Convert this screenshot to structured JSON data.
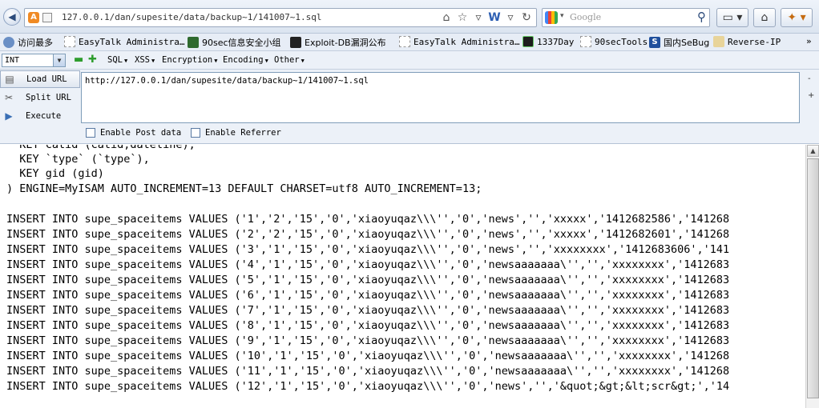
{
  "nav": {
    "url": "127.0.0.1/dan/supesite/data/backup~1/141007~1.sql",
    "search_placeholder": "Google",
    "favicon_letter": "A"
  },
  "bookmarks": [
    {
      "label": "访问最多",
      "icon": "gear-icon"
    },
    {
      "label": "EasyTalk Administra…",
      "icon": "page-icon"
    },
    {
      "label": "90sec信息安全小组",
      "icon": "bug-icon"
    },
    {
      "label": "Exploit-DB漏洞公布",
      "icon": "exploit-db-icon"
    },
    {
      "label": "EasyTalk Administra…",
      "icon": "page-icon"
    },
    {
      "label": "1337Day",
      "icon": "1337day-icon"
    },
    {
      "label": "90secTools",
      "icon": "page-icon"
    },
    {
      "label": "国内SeBug",
      "icon": "s-icon"
    },
    {
      "label": "Reverse-IP",
      "icon": "pencil-icon"
    }
  ],
  "hackbar": {
    "encoding_select": "INT",
    "menus": [
      "SQL",
      "XSS",
      "Encryption",
      "Encoding",
      "Other"
    ],
    "actions": [
      "Load URL",
      "Split URL",
      "Execute"
    ],
    "textarea": "http://127.0.0.1/dan/supesite/data/backup~1/141007~1.sql",
    "checkboxes": [
      "Enable Post data",
      "Enable Referrer"
    ]
  },
  "content": {
    "lines": [
      "  KEY catid (catid,dateline),",
      "  KEY `type` (`type`),",
      "  KEY gid (gid)",
      ") ENGINE=MyISAM AUTO_INCREMENT=13 DEFAULT CHARSET=utf8 AUTO_INCREMENT=13;",
      "",
      "INSERT INTO supe_spaceitems VALUES ('1','2','15','0','xiaoyuqaz\\\\\\'','0','news','','xxxxx','1412682586','141268",
      "INSERT INTO supe_spaceitems VALUES ('2','2','15','0','xiaoyuqaz\\\\\\'','0','news','','xxxxx','1412682601','141268",
      "INSERT INTO supe_spaceitems VALUES ('3','1','15','0','xiaoyuqaz\\\\\\'','0','news','','xxxxxxxx','1412683606','141",
      "INSERT INTO supe_spaceitems VALUES ('4','1','15','0','xiaoyuqaz\\\\\\'','0','newsaaaaaaa\\'','','xxxxxxxx','1412683",
      "INSERT INTO supe_spaceitems VALUES ('5','1','15','0','xiaoyuqaz\\\\\\'','0','newsaaaaaaa\\'','','xxxxxxxx','1412683",
      "INSERT INTO supe_spaceitems VALUES ('6','1','15','0','xiaoyuqaz\\\\\\'','0','newsaaaaaaa\\'','','xxxxxxxx','1412683",
      "INSERT INTO supe_spaceitems VALUES ('7','1','15','0','xiaoyuqaz\\\\\\'','0','newsaaaaaaa\\'','','xxxxxxxx','1412683",
      "INSERT INTO supe_spaceitems VALUES ('8','1','15','0','xiaoyuqaz\\\\\\'','0','newsaaaaaaa\\'','','xxxxxxxx','1412683",
      "INSERT INTO supe_spaceitems VALUES ('9','1','15','0','xiaoyuqaz\\\\\\'','0','newsaaaaaaa\\'','','xxxxxxxx','1412683",
      "INSERT INTO supe_spaceitems VALUES ('10','1','15','0','xiaoyuqaz\\\\\\'','0','newsaaaaaaa\\'','','xxxxxxxx','141268",
      "INSERT INTO supe_spaceitems VALUES ('11','1','15','0','xiaoyuqaz\\\\\\'','0','newsaaaaaaa\\'','','xxxxxxxx','141268",
      "INSERT INTO supe_spaceitems VALUES ('12','1','15','0','xiaoyuqaz\\\\\\'','0','news','','&quot;&gt;&lt;scr&gt;','14"
    ]
  }
}
